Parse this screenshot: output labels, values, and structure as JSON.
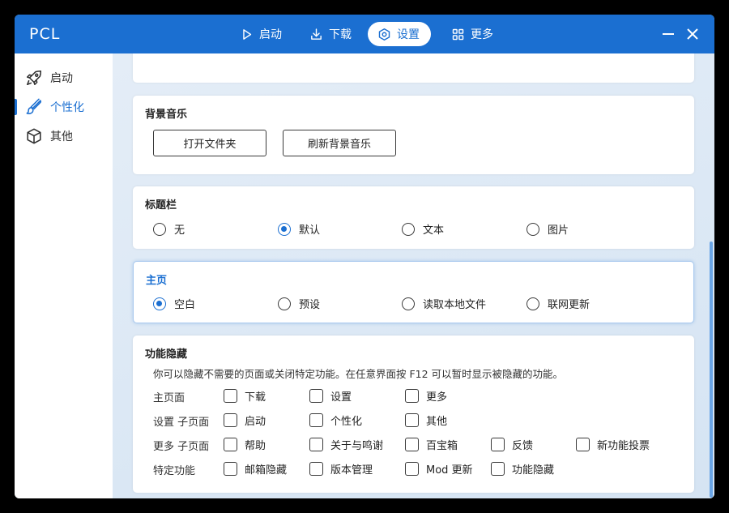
{
  "app": {
    "title": "PCL"
  },
  "nav": [
    {
      "label": "启动",
      "icon": "play-icon"
    },
    {
      "label": "下载",
      "icon": "download-icon"
    },
    {
      "label": "设置",
      "icon": "settings-icon",
      "active": true
    },
    {
      "label": "更多",
      "icon": "grid-icon"
    }
  ],
  "sidebar": {
    "items": [
      {
        "label": "启动",
        "icon": "rocket-icon"
      },
      {
        "label": "个性化",
        "icon": "brush-icon",
        "active": true
      },
      {
        "label": "其他",
        "icon": "box-icon"
      }
    ]
  },
  "music": {
    "title": "背景音乐",
    "open_folder": "打开文件夹",
    "refresh": "刷新背景音乐"
  },
  "titlebar_section": {
    "title": "标题栏",
    "options": [
      "无",
      "默认",
      "文本",
      "图片"
    ],
    "selected": "默认"
  },
  "homepage": {
    "title": "主页",
    "options": [
      "空白",
      "预设",
      "读取本地文件",
      "联网更新"
    ],
    "selected": "空白"
  },
  "hide": {
    "title": "功能隐藏",
    "description": "你可以隐藏不需要的页面或关闭特定功能。在任意界面按 F12 可以暂时显示被隐藏的功能。",
    "rows": [
      {
        "label": "主页面",
        "items": [
          "下载",
          "设置",
          "更多"
        ]
      },
      {
        "label": "设置 子页面",
        "items": [
          "启动",
          "个性化",
          "其他"
        ]
      },
      {
        "label": "更多 子页面",
        "items": [
          "帮助",
          "关于与鸣谢",
          "百宝箱",
          "反馈",
          "新功能投票"
        ]
      },
      {
        "label": "特定功能",
        "items": [
          "邮箱隐藏",
          "版本管理",
          "Mod 更新",
          "功能隐藏"
        ]
      }
    ]
  },
  "colors": {
    "accent": "#1b6fd1",
    "titlebar": "#1b6fd1"
  }
}
